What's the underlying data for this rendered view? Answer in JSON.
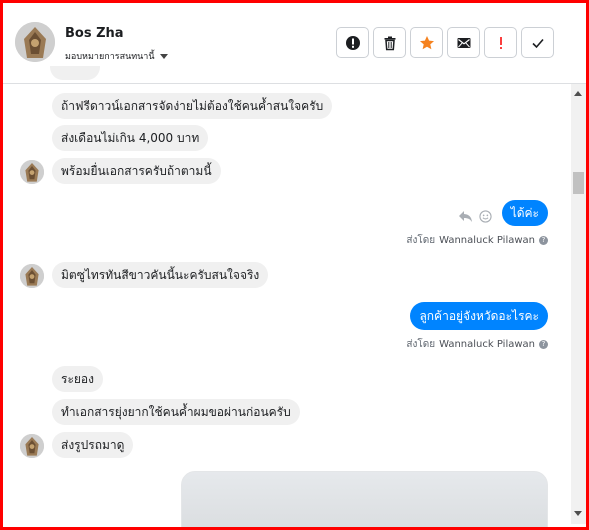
{
  "header": {
    "contact_name": "Bos Zha",
    "assign_label": "มอบหมายการสนทนานี้"
  },
  "actions": [
    {
      "name": "mark-spam-button",
      "icon": "alert-circle-icon",
      "color": "#1c1e21"
    },
    {
      "name": "delete-button",
      "icon": "trash-icon",
      "color": "#1c1e21"
    },
    {
      "name": "star-button",
      "icon": "star-icon",
      "color": "#f5821f"
    },
    {
      "name": "mark-unread-button",
      "icon": "envelope-icon",
      "color": "#1c1e21"
    },
    {
      "name": "follow-up-button",
      "icon": "exclamation-icon",
      "color": "#fa3e3e"
    },
    {
      "name": "mark-done-button",
      "icon": "check-icon",
      "color": "#1c1e21"
    }
  ],
  "messages": [
    {
      "id": "m1",
      "dir": "in",
      "text": "ถ้าฟรีดาวน์เอกสารจัดง่ายไม่ต้องใช้คนค้ำสนใจครับ"
    },
    {
      "id": "m2",
      "dir": "in",
      "text": "ส่งเดือนไม่เกิน 4,000 บาท"
    },
    {
      "id": "m3",
      "dir": "in",
      "text": "พร้อมยื่นเอกสารครับถ้าตามนี้"
    },
    {
      "id": "m4",
      "dir": "out",
      "text": "ได้ค่ะ"
    },
    {
      "id": "m5",
      "dir": "in",
      "text": "มิตซูไทรทันสีขาวคันนี้นะครับสนใจจริง"
    },
    {
      "id": "m6",
      "dir": "out",
      "text": "ลูกค้าอยู่จังหวัดอะไรคะ"
    },
    {
      "id": "m7",
      "dir": "in",
      "text": "ระยอง"
    },
    {
      "id": "m8",
      "dir": "in",
      "text": "ทำเอกสารยุ่งยากใช้คนค้ำผมขอผ่านก่อนครับ"
    },
    {
      "id": "m9",
      "dir": "in",
      "text": "ส่งรูปรถมาดู"
    }
  ],
  "sent_by": {
    "prefix": "ส่งโดย",
    "agent": "Wannaluck Pilawan"
  },
  "colors": {
    "outgoing_bubble": "#0084ff",
    "incoming_bubble": "#f0f0f0",
    "frame_border": "#ff0000"
  }
}
